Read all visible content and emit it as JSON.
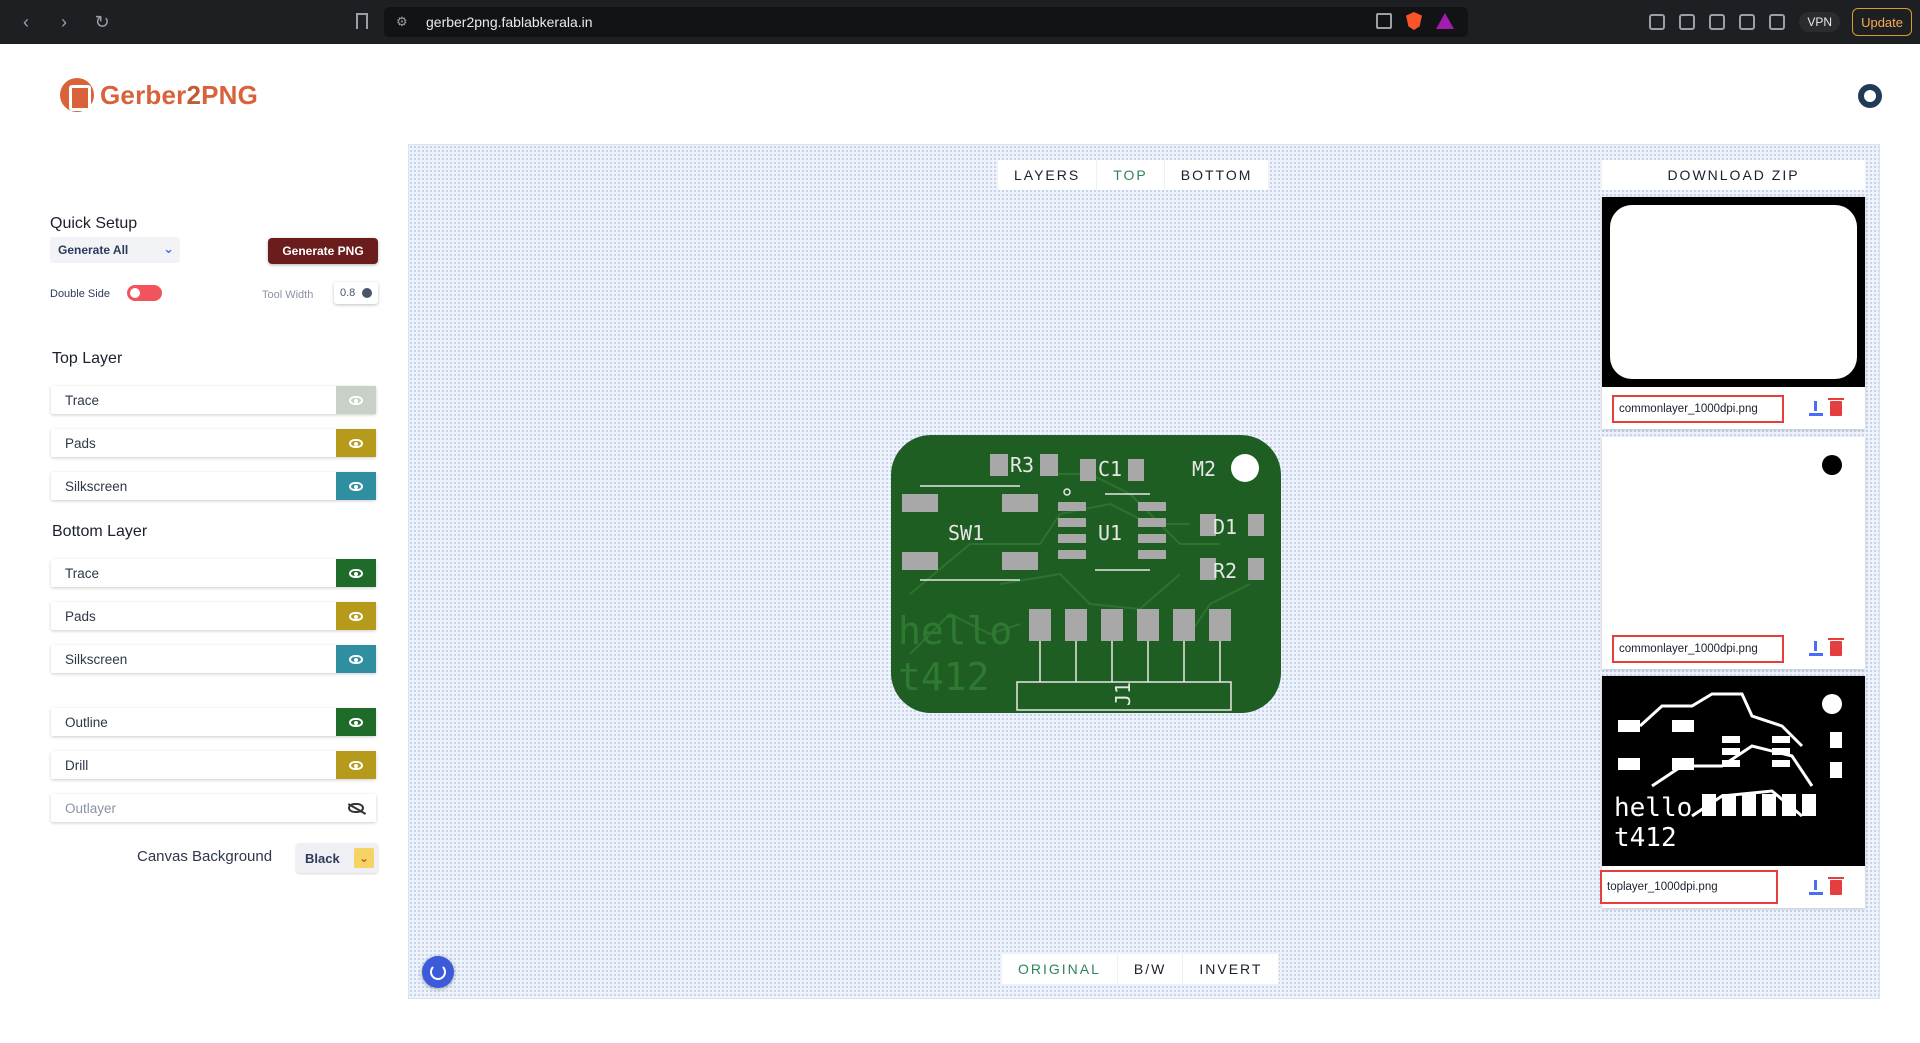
{
  "browser": {
    "url": "gerber2png.fablabkerala.in",
    "vpn_label": "VPN",
    "update_label": "Update"
  },
  "app": {
    "logo_prefix": "Gerber",
    "logo_two": "2",
    "logo_suffix": "PNG"
  },
  "sidebar": {
    "quick_setup_title": "Quick Setup",
    "quick_setup_value": "Generate All",
    "generate_png_label": "Generate PNG",
    "double_side_label": "Double Side",
    "double_side_on": false,
    "tool_width_label": "Tool Width",
    "tool_width_value": "0.8",
    "top_layer_title": "Top Layer",
    "top_layers": [
      {
        "label": "Trace",
        "color": "#c8d0c8"
      },
      {
        "label": "Pads",
        "color": "#b59a1b"
      },
      {
        "label": "Silkscreen",
        "color": "#2f8ea0"
      }
    ],
    "bottom_layer_title": "Bottom Layer",
    "bottom_layers": [
      {
        "label": "Trace",
        "color": "#1f6b2a"
      },
      {
        "label": "Pads",
        "color": "#b59a1b"
      },
      {
        "label": "Silkscreen",
        "color": "#2f8ea0"
      }
    ],
    "other_layers": [
      {
        "label": "Outline",
        "color": "#1f6b2a"
      },
      {
        "label": "Drill",
        "color": "#b59a1b"
      },
      {
        "label": "Outlayer",
        "color": "#ffffff"
      }
    ],
    "canvas_background_label": "Canvas Background",
    "canvas_background_value": "Black"
  },
  "canvas": {
    "top_tabs": [
      "LAYERS",
      "TOP",
      "BOTTOM"
    ],
    "active_top_tab": "TOP",
    "bottom_tabs": [
      "ORIGINAL",
      "B/W",
      "INVERT"
    ],
    "active_bottom_tab": "ORIGINAL",
    "board": {
      "labels": [
        "R3",
        "C1",
        "M2",
        "SW1",
        "U1",
        "D1",
        "R2",
        "J1"
      ],
      "silk_text_1": "hello",
      "silk_text_2": "t412",
      "board_color": "#1f5e22"
    }
  },
  "results": {
    "download_zip_label": "DOWNLOAD ZIP",
    "files": [
      {
        "name": "commonlayer_1000dpi.png"
      },
      {
        "name": "commonlayer_1000dpi.png"
      },
      {
        "name": "toplayer_1000dpi.png"
      }
    ],
    "preview_text_1": "hello",
    "preview_text_2": "t412"
  }
}
